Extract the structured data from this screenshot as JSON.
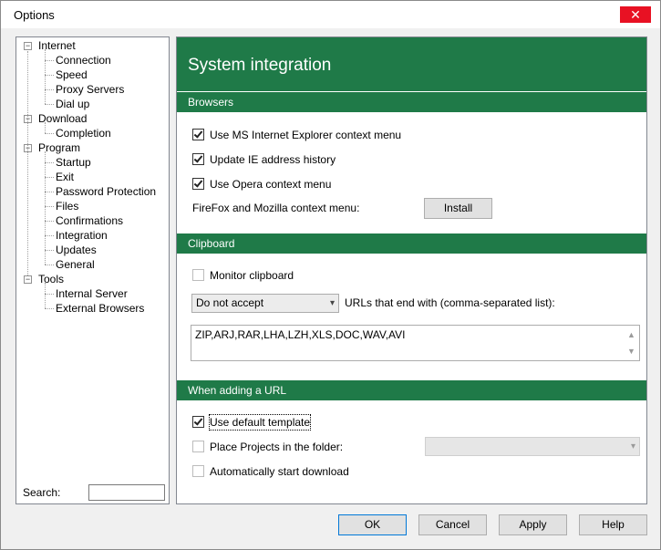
{
  "window": {
    "title": "Options",
    "close_glyph": "✕"
  },
  "tree": {
    "items": [
      {
        "label": "Internet",
        "level": 0,
        "toggle": "−"
      },
      {
        "label": "Connection",
        "level": 1
      },
      {
        "label": "Speed",
        "level": 1
      },
      {
        "label": "Proxy Servers",
        "level": 1
      },
      {
        "label": "Dial up",
        "level": 1
      },
      {
        "label": "Download",
        "level": 0,
        "toggle": "−"
      },
      {
        "label": "Completion",
        "level": 1
      },
      {
        "label": "Program",
        "level": 0,
        "toggle": "−"
      },
      {
        "label": "Startup",
        "level": 1
      },
      {
        "label": "Exit",
        "level": 1
      },
      {
        "label": "Password Protection",
        "level": 1
      },
      {
        "label": "Files",
        "level": 1
      },
      {
        "label": "Confirmations",
        "level": 1
      },
      {
        "label": "Integration",
        "level": 1
      },
      {
        "label": "Updates",
        "level": 1
      },
      {
        "label": "General",
        "level": 1
      },
      {
        "label": "Tools",
        "level": 0,
        "toggle": "−"
      },
      {
        "label": "Internal Server",
        "level": 1
      },
      {
        "label": "External Browsers",
        "level": 1
      }
    ],
    "search_label": "Search:",
    "search_value": ""
  },
  "panel": {
    "title": "System integration",
    "browsers": {
      "heading": "Browsers",
      "ie_context": {
        "label": "Use MS Internet Explorer context menu",
        "checked": true
      },
      "ie_history": {
        "label": "Update IE address history",
        "checked": true
      },
      "opera_context": {
        "label": "Use Opera context menu",
        "checked": true
      },
      "firefox_label": "FireFox and Mozilla context menu:",
      "install_button": "Install"
    },
    "clipboard": {
      "heading": "Clipboard",
      "monitor": {
        "label": "Monitor clipboard",
        "checked": false
      },
      "accept_select": "Do not accept",
      "urls_label": "URLs that end with (comma-separated list):",
      "extensions": "ZIP,ARJ,RAR,LHA,LZH,XLS,DOC,WAV,AVI"
    },
    "adding_url": {
      "heading": "When adding a URL",
      "default_template": {
        "label": "Use default template",
        "checked": true
      },
      "place_projects": {
        "label": "Place Projects in the folder:",
        "checked": false
      },
      "folder_select": "",
      "auto_start": {
        "label": "Automatically start download",
        "checked": false
      }
    }
  },
  "buttons": {
    "ok": "OK",
    "cancel": "Cancel",
    "apply": "Apply",
    "help": "Help"
  },
  "colors": {
    "accent_green": "#1f7a48",
    "close_red": "#e81123"
  },
  "icons": {
    "dropdown": "▾",
    "scroll_up": "▲",
    "scroll_down": "▼"
  }
}
